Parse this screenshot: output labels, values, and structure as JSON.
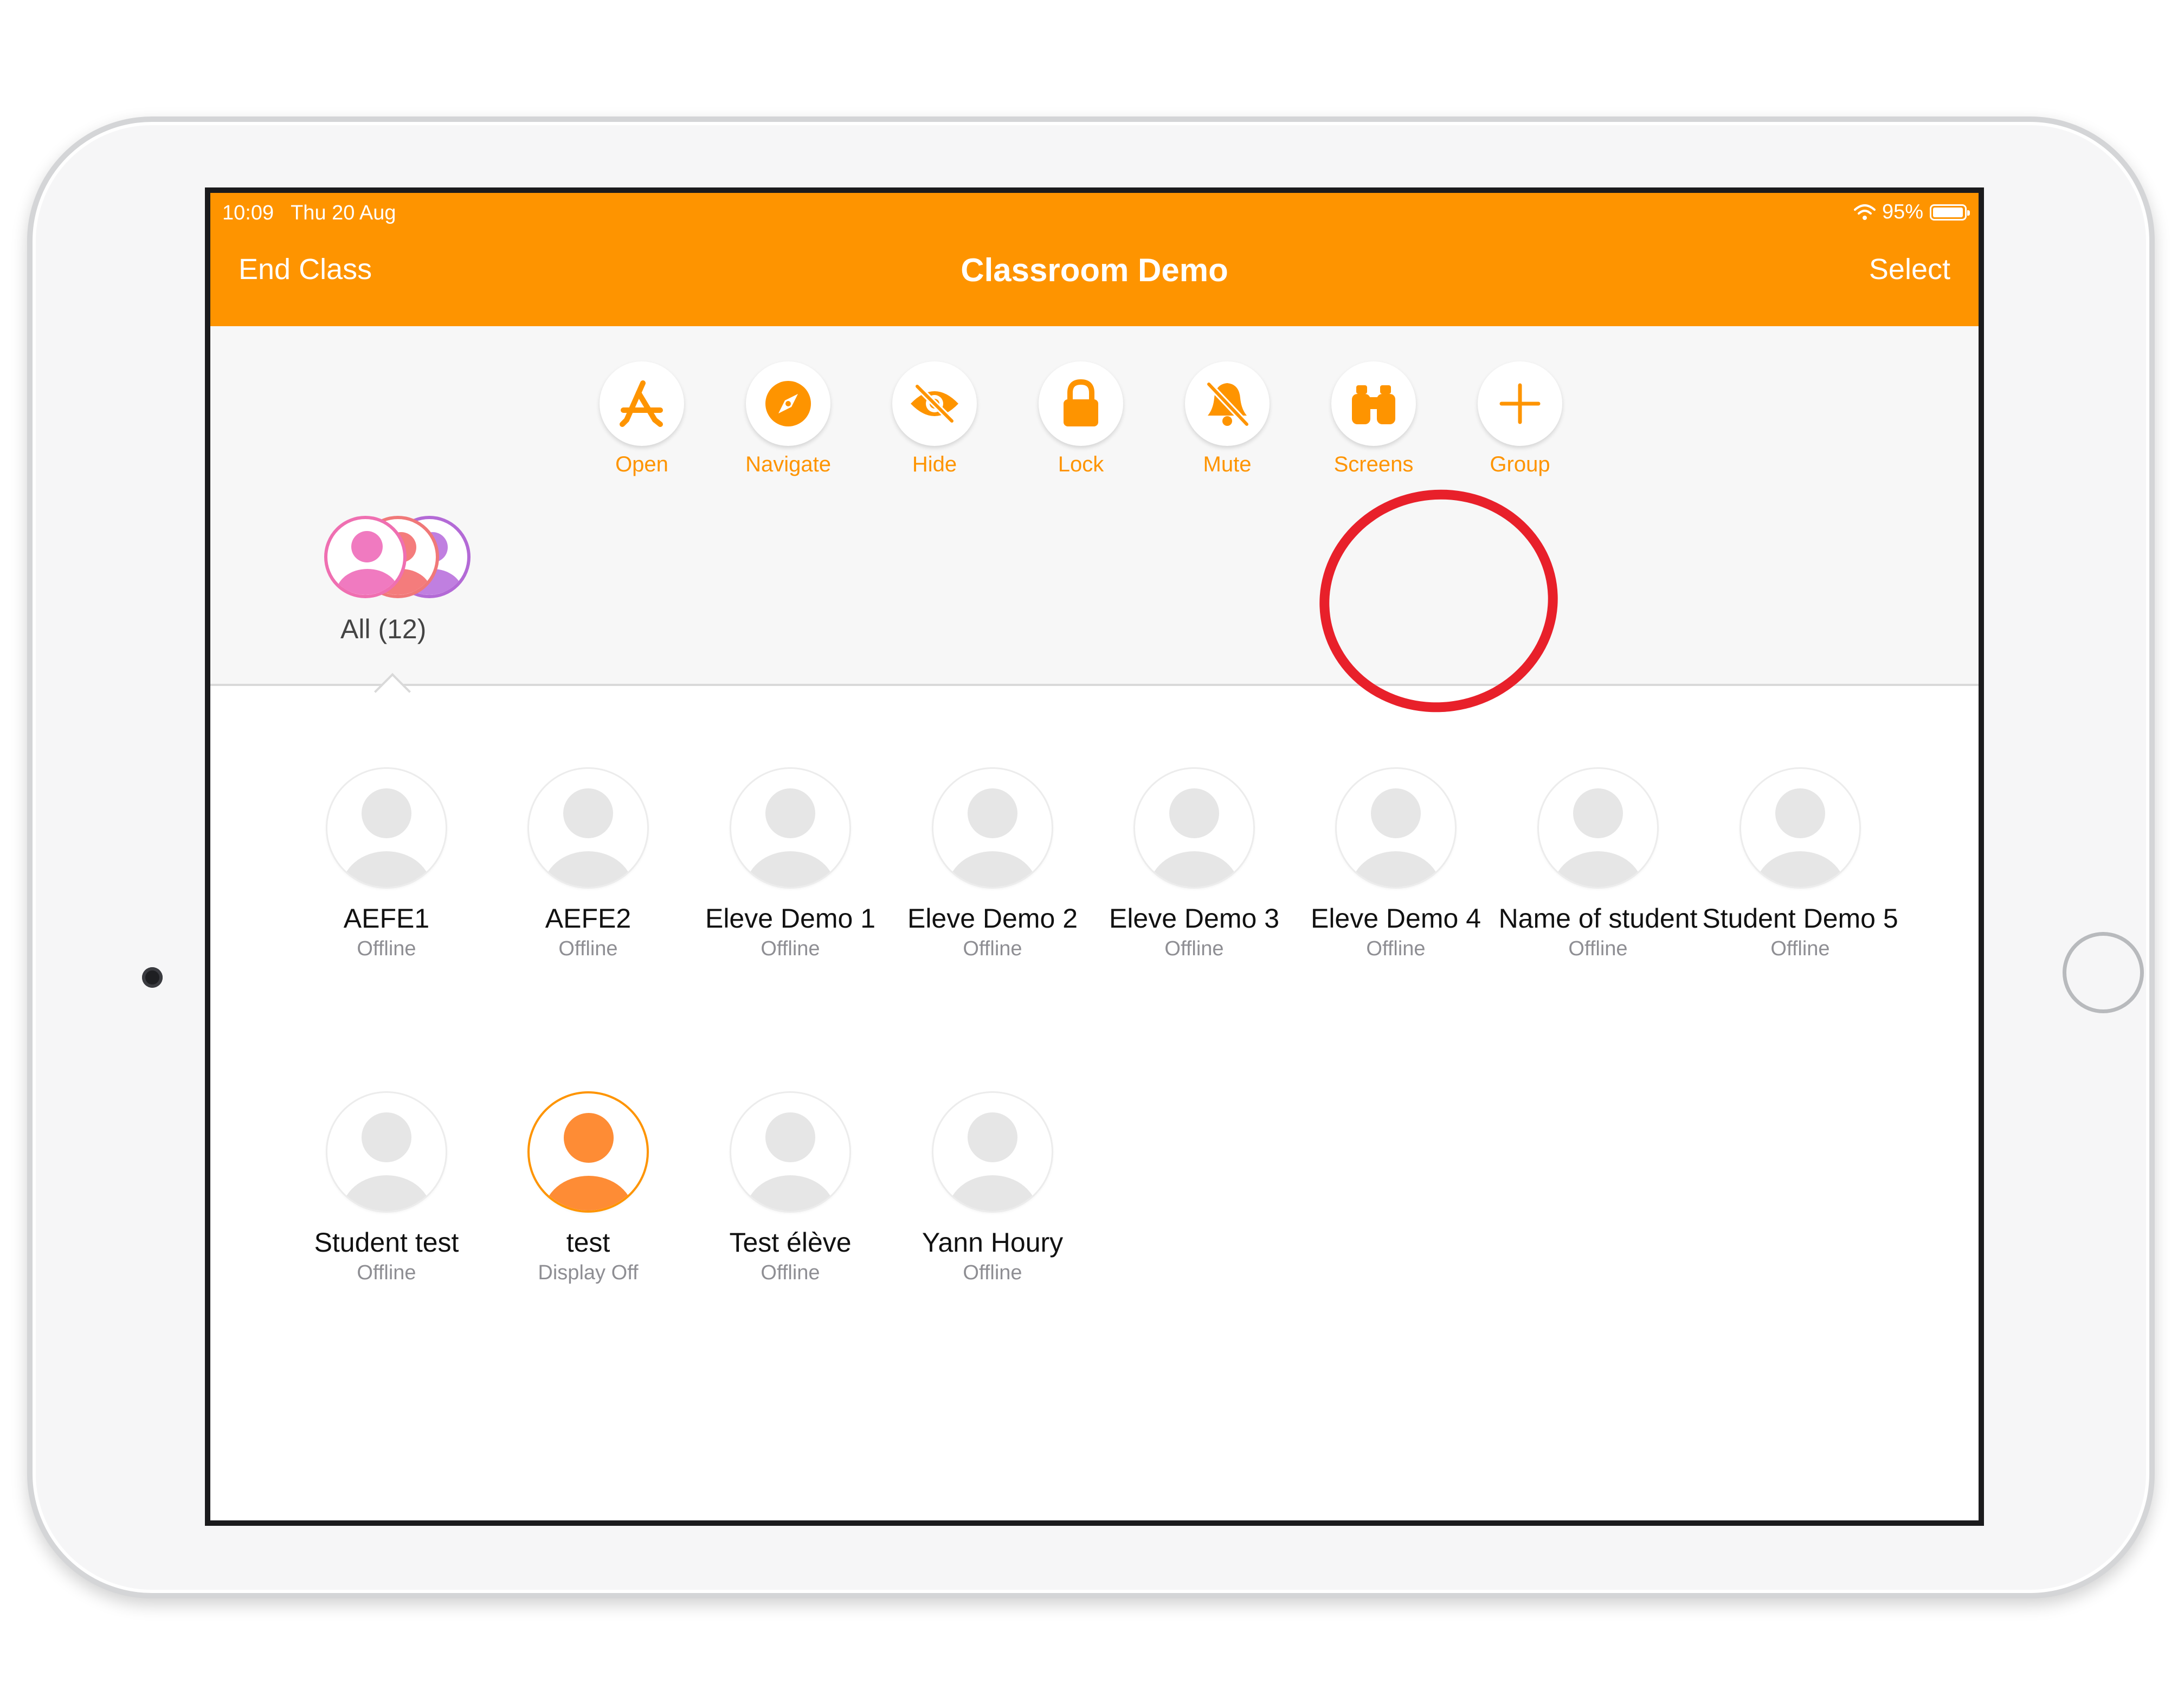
{
  "status_bar": {
    "time": "10:09",
    "date": "Thu 20 Aug",
    "battery": "95%"
  },
  "nav": {
    "left_button": "End Class",
    "title": "Classroom Demo",
    "right_button": "Select"
  },
  "actions": [
    {
      "label": "Open",
      "icon": "app-store-icon"
    },
    {
      "label": "Navigate",
      "icon": "compass-icon"
    },
    {
      "label": "Hide",
      "icon": "eye-slash-icon"
    },
    {
      "label": "Lock",
      "icon": "lock-icon"
    },
    {
      "label": "Mute",
      "icon": "bell-slash-icon"
    },
    {
      "label": "Screens",
      "icon": "binoculars-icon"
    },
    {
      "label": "Group",
      "icon": "plus-icon"
    }
  ],
  "groups": [
    {
      "label": "All (12)"
    }
  ],
  "students": [
    {
      "name": "AEFE1",
      "status": "Offline"
    },
    {
      "name": "AEFE2",
      "status": "Offline"
    },
    {
      "name": "Eleve Demo 1",
      "status": "Offline"
    },
    {
      "name": "Eleve Demo 2",
      "status": "Offline"
    },
    {
      "name": "Eleve Demo 3",
      "status": "Offline"
    },
    {
      "name": "Eleve Demo 4",
      "status": "Offline"
    },
    {
      "name": "Name of student",
      "status": "Offline"
    },
    {
      "name": "Student Demo 5",
      "status": "Offline"
    },
    {
      "name": "Student test",
      "status": "Offline"
    },
    {
      "name": "test",
      "status": "Display Off"
    },
    {
      "name": "Test élève",
      "status": "Offline"
    },
    {
      "name": "Yann Houry",
      "status": "Offline"
    }
  ],
  "colors": {
    "accent": "#fe9400",
    "highlight": "#e8202a",
    "status_text": "#8e8e93"
  }
}
